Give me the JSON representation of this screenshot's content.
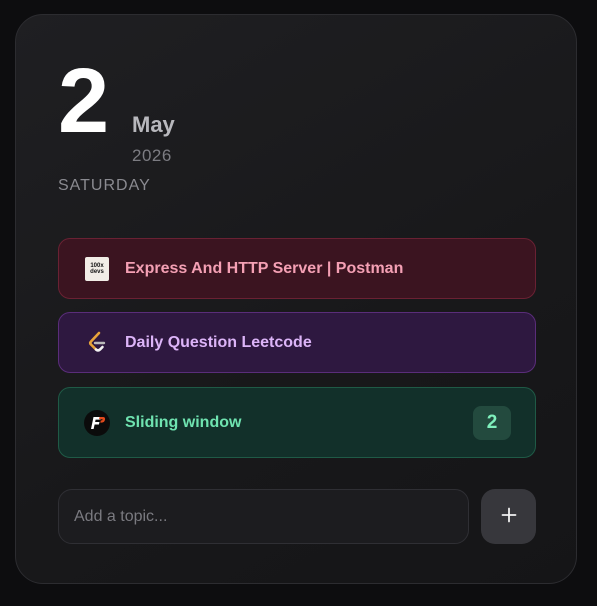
{
  "date": {
    "day": "2",
    "month": "May",
    "year": "2026",
    "weekday": "SATURDAY"
  },
  "tasks": [
    {
      "label": "Express And HTTP Server | Postman",
      "logo_icon": "100xdevs-logo-icon",
      "logo_text_top": "100x",
      "logo_text_bottom": "devs",
      "color": "#f4a0b4",
      "bg": "#3b1420"
    },
    {
      "label": "Daily Question Leetcode",
      "logo_icon": "leetcode-logo-icon",
      "color": "#dcb4f8",
      "bg": "#2e1840"
    },
    {
      "label": "Sliding window",
      "logo_icon": "fp-logo-icon",
      "count": "2",
      "color": "#6fe3b0",
      "bg": "#12302a"
    }
  ],
  "topic_input": {
    "value": "",
    "placeholder": "Add a topic..."
  },
  "add_button": {
    "icon": "plus-icon"
  }
}
